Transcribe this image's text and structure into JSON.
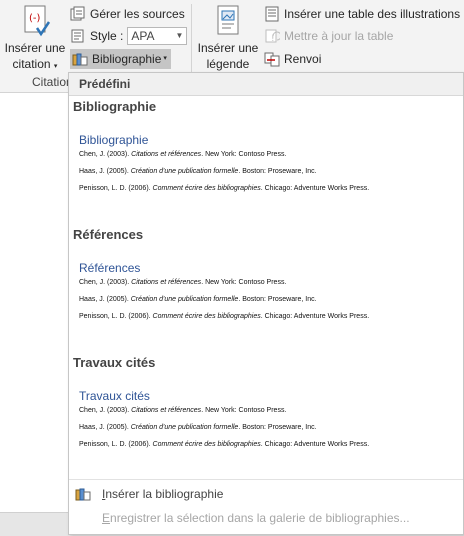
{
  "ribbon": {
    "insert_citation": {
      "line1": "Insérer une",
      "line2": "citation"
    },
    "manage_sources": "Gérer les sources",
    "style_label": "Style :",
    "style_value": "APA",
    "bibliography_button": "Bibliographie",
    "group_citations": "Citation",
    "insert_caption": {
      "line1": "Insérer une",
      "line2": "légende"
    },
    "insert_table_of_figures": "Insérer une table des illustrations",
    "update_table": "Mettre à jour la table",
    "cross_reference": "Renvoi"
  },
  "gallery": {
    "header": "Prédéfini",
    "items": [
      {
        "title": "Bibliographie",
        "heading": "Bibliographie",
        "entries": [
          {
            "pre": "Chen, J. (2003). ",
            "it": "Citations et références",
            "post": ". New York: Contoso Press."
          },
          {
            "pre": "Haas, J. (2005). ",
            "it": "Création d'une publication formelle",
            "post": ". Boston: Proseware, Inc."
          },
          {
            "pre": "Penisson, L. D. (2006). ",
            "it": "Comment écrire des bibliographies",
            "post": ". Chicago: Adventure Works Press."
          }
        ]
      },
      {
        "title": "Références",
        "heading": "Références",
        "entries": [
          {
            "pre": "Chen, J. (2003). ",
            "it": "Citations et références",
            "post": ". New York: Contoso Press."
          },
          {
            "pre": "Haas, J. (2005). ",
            "it": "Création d'une publication formelle",
            "post": ". Boston: Proseware, Inc."
          },
          {
            "pre": "Penisson, L. D. (2006). ",
            "it": "Comment écrire des bibliographies",
            "post": ". Chicago: Adventure Works Press."
          }
        ]
      },
      {
        "title": "Travaux cités",
        "heading": "Travaux cités",
        "entries": [
          {
            "pre": "Chen, J. (2003). ",
            "it": "Citations et références",
            "post": ". New York: Contoso Press."
          },
          {
            "pre": "Haas, J. (2005). ",
            "it": "Création d'une publication formelle",
            "post": ". Boston: Proseware, Inc."
          },
          {
            "pre": "Penisson, L. D. (2006). ",
            "it": "Comment écrire des bibliographies",
            "post": ". Chicago: Adventure Works Press."
          }
        ]
      }
    ],
    "insert_bibliography": "Insérer la bibliographie",
    "insert_bibliography_underline": "I",
    "insert_bibliography_rest": "nsérer la bibliographie",
    "save_selection": "Enregistrer la sélection dans la galerie de bibliographies...",
    "save_selection_underline": "E",
    "save_selection_rest": "nregistrer la sélection dans la galerie de bibliographies..."
  },
  "colors": {
    "heading_blue": "#2f5496",
    "ribbon_bg": "#f3f3f3",
    "active_bg": "#c5c5c5",
    "disabled_text": "#a6a6a6"
  },
  "icons": {
    "insert_citation": "citation-icon",
    "manage_sources": "manage-sources-icon",
    "style": "style-icon",
    "bibliography": "bibliography-icon",
    "insert_caption": "caption-icon",
    "table_of_figures": "table-of-figures-icon",
    "update_table": "update-table-icon",
    "cross_reference": "cross-reference-icon"
  }
}
